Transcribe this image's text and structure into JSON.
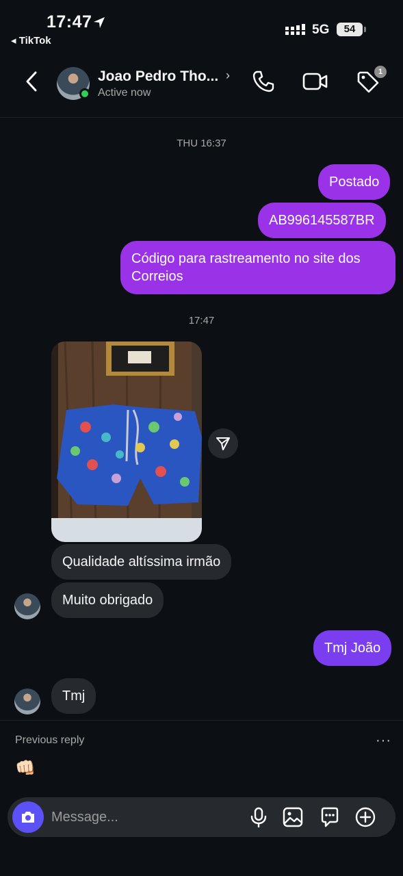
{
  "status_bar": {
    "time": "17:47",
    "back_app": "◂ TikTok",
    "network": "5G",
    "battery": "54"
  },
  "header": {
    "contact_name": "Joao Pedro Tho...",
    "status": "Active now",
    "tag_badge": "1"
  },
  "messages": {
    "timestamp_1": "THU 16:37",
    "out_1": "Postado",
    "out_2": "AB996145587BR",
    "out_3_line1": "Código para rastreamento no site dos",
    "out_3_line2": "Correios",
    "timestamp_2": "17:47",
    "in_1": "Qualidade altíssima irmão",
    "in_2": "Muito obrigado",
    "out_4": "Tmj João",
    "in_3": "Tmj"
  },
  "previous_reply": {
    "label": "Previous reply",
    "more": "···",
    "emoji": "👊🏻"
  },
  "composer": {
    "placeholder": "Message..."
  },
  "colors": {
    "outgoing": "#9a32e8",
    "incoming": "#262a2f",
    "camera": "#5b51f5",
    "online": "#2ed158"
  }
}
